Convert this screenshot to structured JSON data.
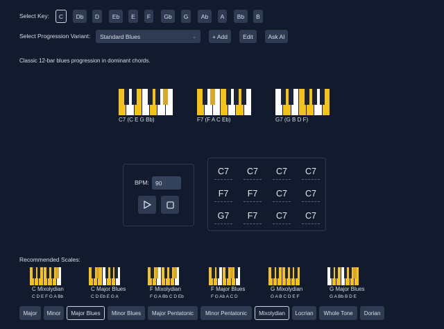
{
  "key_selector": {
    "label": "Select Key:",
    "keys": [
      "C",
      "Db",
      "D",
      "Eb",
      "E",
      "F",
      "Gb",
      "G",
      "Ab",
      "A",
      "Bb",
      "B"
    ],
    "selected": "C"
  },
  "progression": {
    "label": "Select Progression Variant:",
    "value": "Standard Blues",
    "add": "+ Add",
    "edit": "Edit",
    "ask_ai": "Ask AI",
    "description": "Classic 12-bar blues progression in dominant chords."
  },
  "chords": [
    {
      "label": "C7 (C E G Bb)",
      "notes": [
        "C",
        "E",
        "G",
        "Bb"
      ]
    },
    {
      "label": "F7 (F A C Eb)",
      "notes": [
        "F",
        "A",
        "C",
        "Eb"
      ]
    },
    {
      "label": "G7 (G B D F)",
      "notes": [
        "G",
        "B",
        "D",
        "F"
      ]
    }
  ],
  "player": {
    "bpm_label": "BPM:",
    "bpm": "90",
    "play_icon": "play-icon",
    "stop_icon": "stop-icon"
  },
  "grid": [
    "C7",
    "C7",
    "C7",
    "C7",
    "F7",
    "F7",
    "C7",
    "C7",
    "G7",
    "F7",
    "C7",
    "C7"
  ],
  "scales_title": "Recommended Scales:",
  "scales": [
    {
      "name": "C Mixolydian",
      "notes": "C D E F G A Bb",
      "hl": [
        "C",
        "D",
        "E",
        "F",
        "G",
        "A",
        "Bb"
      ]
    },
    {
      "name": "C Major Blues",
      "notes": "C D Eb E G A",
      "hl": [
        "C",
        "D",
        "Eb",
        "E",
        "G",
        "A"
      ]
    },
    {
      "name": "F Mixolydian",
      "notes": "F G A Bb C D Eb",
      "hl": [
        "F",
        "G",
        "A",
        "Bb",
        "C",
        "D",
        "Eb"
      ]
    },
    {
      "name": "F Major Blues",
      "notes": "F G Ab A C D",
      "hl": [
        "F",
        "G",
        "Ab",
        "A",
        "C",
        "D"
      ]
    },
    {
      "name": "G Mixolydian",
      "notes": "G A B C D E F",
      "hl": [
        "G",
        "A",
        "B",
        "C",
        "D",
        "E",
        "F"
      ]
    },
    {
      "name": "G Major Blues",
      "notes": "G A Bb B D E",
      "hl": [
        "G",
        "A",
        "Bb",
        "B",
        "D",
        "E"
      ]
    }
  ],
  "scale_types": [
    {
      "label": "Major",
      "selected": false
    },
    {
      "label": "Minor",
      "selected": false
    },
    {
      "label": "Major Blues",
      "selected": true
    },
    {
      "label": "Minor Blues",
      "selected": false
    },
    {
      "label": "Major Pentatonic",
      "selected": false
    },
    {
      "label": "Minor Pentatonic",
      "selected": false
    },
    {
      "label": "Mixolydian",
      "selected": true
    },
    {
      "label": "Locrian",
      "selected": false
    },
    {
      "label": "Whole Tone",
      "selected": false
    },
    {
      "label": "Dorian",
      "selected": false
    }
  ],
  "colors": {
    "background": "#121a2d",
    "button": "#2e3b53",
    "highlight": "#f5c21a"
  }
}
